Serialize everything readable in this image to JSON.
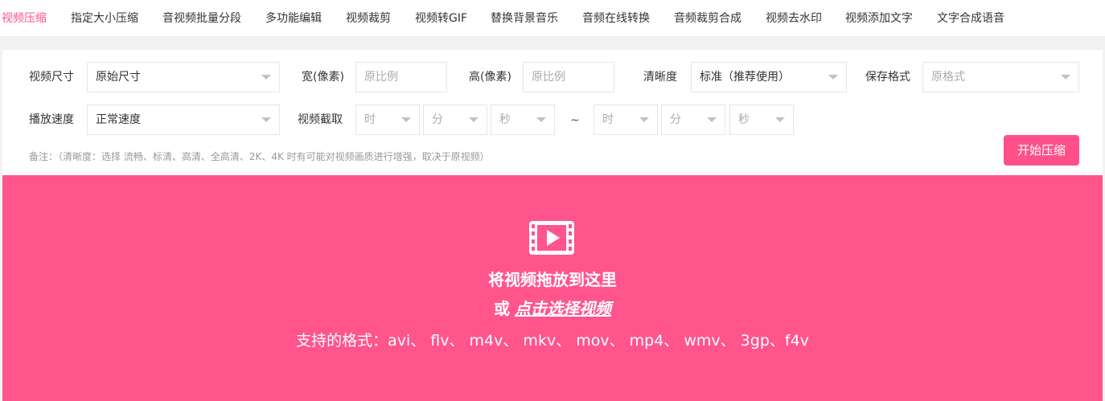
{
  "nav": {
    "tabs": [
      {
        "label": "视频压缩",
        "active": true
      },
      {
        "label": "指定大小压缩"
      },
      {
        "label": "音视频批量分段"
      },
      {
        "label": "多功能编辑"
      },
      {
        "label": "视频裁剪"
      },
      {
        "label": "视频转GIF"
      },
      {
        "label": "替换背景音乐"
      },
      {
        "label": "音频在线转换"
      },
      {
        "label": "音频裁剪合成"
      },
      {
        "label": "视频去水印"
      },
      {
        "label": "视频添加文字"
      },
      {
        "label": "文字合成语音"
      }
    ]
  },
  "form": {
    "size_label": "视频尺寸",
    "size_value": "原始尺寸",
    "width_label": "宽(像素)",
    "width_placeholder": "原比例",
    "height_label": "高(像素)",
    "height_placeholder": "原比例",
    "quality_label": "清晰度",
    "quality_value": "标准（推荐使用）",
    "format_label": "保存格式",
    "format_placeholder": "原格式",
    "speed_label": "播放速度",
    "speed_value": "正常速度",
    "clip_label": "视频截取",
    "hour_placeholder": "时",
    "minute_placeholder": "分",
    "second_placeholder": "秒",
    "range_separator": "~",
    "note": "备注：（清晰度：选择 流畅、标清、高清、全高清、2K、4K 时有可能对视频画质进行增强，取决于原视频）",
    "start_button": "开始压缩"
  },
  "dropzone": {
    "icon": "film-play-icon",
    "title": "将视频拖放到这里",
    "or_text": "或",
    "choose_link": "点击选择视频",
    "formats": "支持的格式：avi、 flv、 m4v、 mkv、 mov、 mp4、 wmv、 3gp、f4v"
  },
  "colors": {
    "accent": "#ff5089",
    "dropzone_bg": "#ff548c"
  }
}
